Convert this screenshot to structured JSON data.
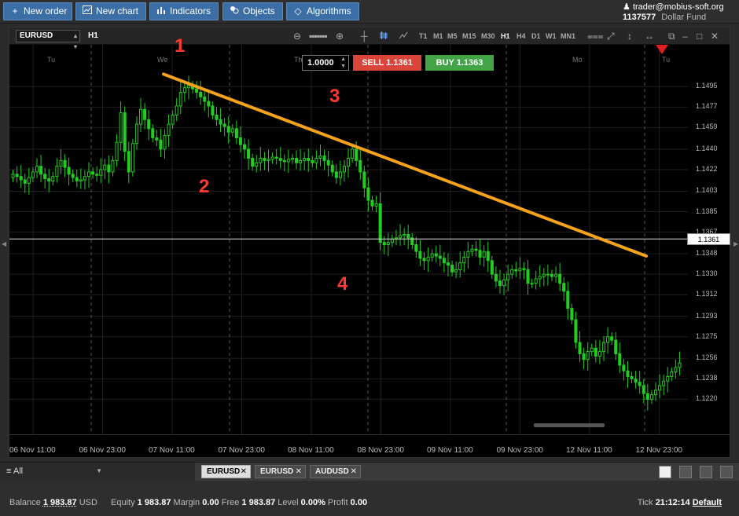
{
  "toolbar": {
    "new_order": "New order",
    "new_chart": "New chart",
    "indicators": "Indicators",
    "objects": "Objects",
    "algorithms": "Algorithms"
  },
  "account": {
    "user": "trader@mobius-soft.org",
    "number": "1137577",
    "fund": "Dollar Fund"
  },
  "chart": {
    "symbol": "EURUSD",
    "timeframe": "H1",
    "timeframes": [
      "T1",
      "M1",
      "M5",
      "M15",
      "M30",
      "H1",
      "H4",
      "D1",
      "W1",
      "MN1"
    ],
    "active_timeframe": "H1",
    "quantity": "1.0000",
    "sell_label": "SELL 1.1361",
    "buy_label": "BUY 1.1363",
    "current_price": "1.1361",
    "current_price_value": 1.1361,
    "day_labels": [
      "Tu",
      "We",
      "Th",
      "Mo",
      "Tu"
    ],
    "annotations": [
      "1",
      "2",
      "3",
      "4"
    ],
    "colors": {
      "bull": "#22cc22",
      "trendline": "#f7a21b",
      "sell": "#d9443b",
      "buy": "#43a347",
      "accent": "#3a6ea5"
    }
  },
  "chart_data": {
    "type": "candlestick",
    "y_ticks": [
      "1.1495",
      "1.1477",
      "1.1459",
      "1.1440",
      "1.1422",
      "1.1403",
      "1.1385",
      "1.1367",
      "1.1348",
      "1.1330",
      "1.1312",
      "1.1293",
      "1.1275",
      "1.1256",
      "1.1238",
      "1.1220"
    ],
    "ylim": [
      1.1203,
      1.1518
    ],
    "x_ticks": [
      "06 Nov 11:00",
      "06 Nov 23:00",
      "07 Nov 11:00",
      "07 Nov 23:00",
      "08 Nov 11:00",
      "08 Nov 23:00",
      "09 Nov 11:00",
      "09 Nov 23:00",
      "12 Nov 11:00",
      "12 Nov 23:00"
    ],
    "closes": [
      1.1418,
      1.1416,
      1.1413,
      1.141,
      1.1415,
      1.142,
      1.1425,
      1.1418,
      1.1414,
      1.1412,
      1.1416,
      1.1425,
      1.143,
      1.1424,
      1.1418,
      1.1415,
      1.1412,
      1.1413,
      1.1416,
      1.142,
      1.1418,
      1.1417,
      1.1422,
      1.1426,
      1.142,
      1.143,
      1.1446,
      1.1472,
      1.1438,
      1.142,
      1.1445,
      1.1462,
      1.1475,
      1.1466,
      1.1458,
      1.145,
      1.1448,
      1.144,
      1.1452,
      1.1462,
      1.147,
      1.1478,
      1.149,
      1.1494,
      1.1496,
      1.1493,
      1.149,
      1.1486,
      1.1482,
      1.1478,
      1.147,
      1.1466,
      1.1462,
      1.146,
      1.1455,
      1.1458,
      1.145,
      1.1444,
      1.144,
      1.1432,
      1.1425,
      1.1428,
      1.1432,
      1.143,
      1.1431,
      1.1433,
      1.1432,
      1.143,
      1.1429,
      1.1431,
      1.1432,
      1.1428,
      1.143,
      1.1432,
      1.143,
      1.1428,
      1.1432,
      1.1434,
      1.143,
      1.1426,
      1.142,
      1.1415,
      1.142,
      1.1425,
      1.1432,
      1.144,
      1.143,
      1.142,
      1.1406,
      1.1395,
      1.139,
      1.1392,
      1.1358,
      1.1356,
      1.1358,
      1.1361,
      1.1362,
      1.1364,
      1.1365,
      1.1362,
      1.1356,
      1.135,
      1.1344,
      1.1342,
      1.1345,
      1.1348,
      1.1346,
      1.1344,
      1.134,
      1.1338,
      1.1332,
      1.1334,
      1.134,
      1.1345,
      1.135,
      1.1352,
      1.1351,
      1.1345,
      1.135,
      1.1342,
      1.133,
      1.1324,
      1.132,
      1.1325,
      1.133,
      1.1334,
      1.1333,
      1.1335,
      1.1334,
      1.1322,
      1.1322,
      1.1326,
      1.1328,
      1.133,
      1.133,
      1.1328,
      1.133,
      1.1322,
      1.1315,
      1.13,
      1.129,
      1.127,
      1.126,
      1.1255,
      1.1262,
      1.1265,
      1.1258,
      1.1262,
      1.127,
      1.1275,
      1.1272,
      1.126,
      1.125,
      1.1245,
      1.124,
      1.1238,
      1.1235,
      1.1232,
      1.1225,
      1.122,
      1.1224,
      1.1228,
      1.1232,
      1.1236,
      1.124,
      1.1244,
      1.1248,
      1.1252
    ]
  },
  "tabs": {
    "filter": "All",
    "items": [
      "EURUSD",
      "EURUSD",
      "AUDUSD"
    ]
  },
  "status": {
    "balance_label": "Balance",
    "balance": "1 983.87",
    "balance_ccy": "USD",
    "equity_label": "Equity",
    "equity": "1 983.87",
    "margin_label": "Margin",
    "margin": "0.00",
    "free_label": "Free",
    "free": "1 983.87",
    "level_label": "Level",
    "level": "0.00%",
    "profit_label": "Profit",
    "profit": "0.00",
    "tick_label": "Tick",
    "tick": "21:12:14",
    "profile": "Default"
  }
}
